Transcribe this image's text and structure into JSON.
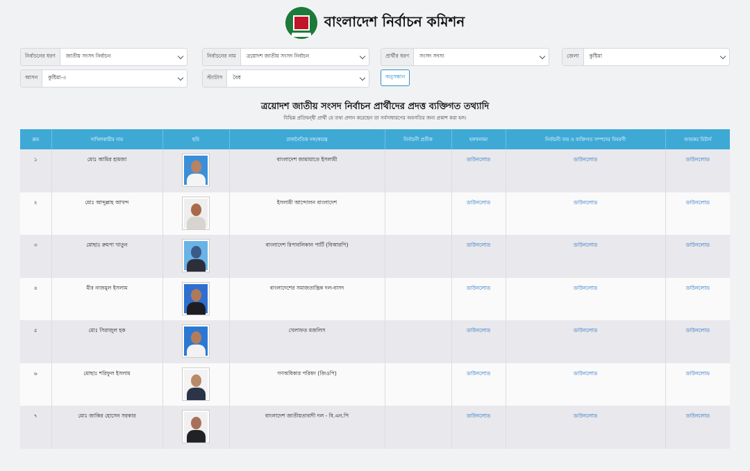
{
  "site": {
    "title": "বাংলাদেশ নির্বাচন কমিশন"
  },
  "filters": {
    "election_type": {
      "label": "নির্বাচনের ধরণ",
      "value": "জাতীয় সংসদ নির্বাচন"
    },
    "election_name": {
      "label": "নির্বাচনের নাম",
      "value": "ত্রয়োদশ জাতীয় সংসদ নির্বাচন"
    },
    "candidate_type": {
      "label": "প্রার্থীর ধরণ",
      "value": "সংসদ সদস্য"
    },
    "district": {
      "label": "জেলা",
      "value": "কুষ্টিয়া"
    },
    "seat": {
      "label": "আসন",
      "value": "কুষ্টিয়া-৩"
    },
    "status": {
      "label": "স্ট্যাটাস",
      "value": "বৈধ"
    },
    "search_label": "অনুসন্ধান"
  },
  "section": {
    "title": "ত্রয়োদশ জাতীয় সংসদ নির্বাচন প্রার্থীদের প্রদত্ত ব্যক্তিগত তথ্যাদি",
    "subtitle": "বিভিন্ন প্রতিদ্বন্দ্বী প্রার্থী যে তথ্য প্রদান করেছেন তা সর্বসাধারণের অবগতির জন্য প্রকাশ করা হল।"
  },
  "table": {
    "headers": [
      "ক্রম",
      "দাখিলকারীর নাম",
      "ছবি",
      "রাজনৈতিক দল/স্বতন্ত্র",
      "নির্বাচনী প্রতীক",
      "হলফনামা",
      "নির্বাচনী ব্যয় ও ব্যক্তিগত সম্পদের বিবরণী",
      "আয়কর রিটার্ন"
    ],
    "download_label": "ডাউনলোড",
    "rows": [
      {
        "serial": "১",
        "name": "মোঃ আমির হামজা",
        "party": "বাংলাদেশ জামায়াতে ইসলামী"
      },
      {
        "serial": "২",
        "name": "মোঃ আব্দুল্লাহ আখন্দ",
        "party": "ইসলামী আন্দোলন বাংলাদেশ"
      },
      {
        "serial": "৩",
        "name": "মোছাঃ রুমপা খাতুন",
        "party": "বাংলাদেশ রিপাবলিকান পার্টি (বিআরপি)"
      },
      {
        "serial": "৪",
        "name": "মীর নাজমুল ইসলাম",
        "party": "বাংলাদেশের সমাজতান্ত্রিক দল-বাসদ"
      },
      {
        "serial": "৫",
        "name": "মোঃ সিরাজুল হক",
        "party": "খেলাফত মজলিস"
      },
      {
        "serial": "৬",
        "name": "মোছাঃ শরিফুল ইসলাম",
        "party": "গণঅধিকার পরিষদ (জিওপি)"
      },
      {
        "serial": "৭",
        "name": "মোঃ জাকির হোসেন সরকার",
        "party": "বাংলাদেশ জাতীয়তাবাদী দল - বি.এন.পি"
      }
    ]
  },
  "colors": {
    "header_bg": "#3fa9d6",
    "link": "#2471c4",
    "logo_green": "#1d7a3a",
    "logo_red": "#c0152a"
  }
}
